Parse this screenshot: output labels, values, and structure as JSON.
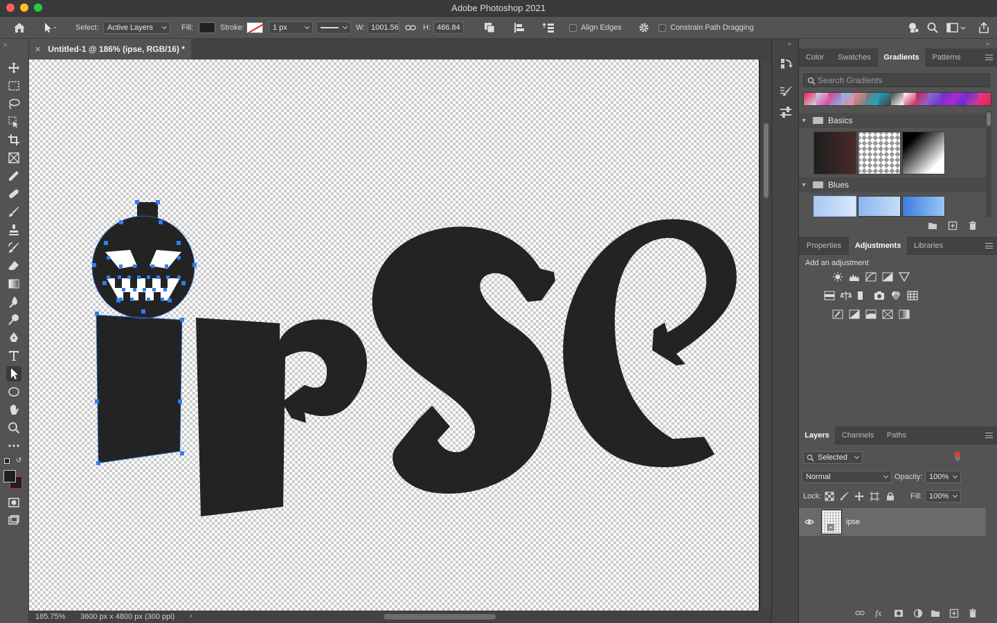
{
  "window": {
    "app_title": "Adobe Photoshop 2021"
  },
  "options_bar": {
    "select_label": "Select:",
    "select_value": "Active Layers",
    "fill_label": "Fill:",
    "stroke_label": "Stroke:",
    "stroke_width": "1 px",
    "w_label": "W:",
    "w_value": "1001.56",
    "h_label": "H:",
    "h_value": "486.84",
    "align_edges": "Align Edges",
    "constrain": "Constrain Path Dragging"
  },
  "document": {
    "tab_title": "Untitled-1 @ 186% (ipse, RGB/16) *",
    "zoom": "185.75%",
    "doc_info": "3600 px x 4800 px (300 ppi)",
    "artwork_text": "ipse"
  },
  "color_panel": {
    "tabs": [
      "Color",
      "Swatches",
      "Gradients",
      "Patterns"
    ],
    "active_tab": "Gradients",
    "search_placeholder": "Search Gradients",
    "groups": [
      {
        "name": "Basics"
      },
      {
        "name": "Blues"
      }
    ],
    "preset_colors": [
      "#e8244d",
      "#c7d7f0",
      "#e43a8f",
      "#7fb6ee",
      "#f18a93",
      "#7a7a7a",
      "#1aa6c2",
      "#444444",
      "#ffffff",
      "#c91f55",
      "#8c6fd6",
      "#6b31c9",
      "#b72ad1",
      "#5c2fd4",
      "#e23b8e"
    ]
  },
  "adjust_panel": {
    "tabs": [
      "Properties",
      "Adjustments",
      "Libraries"
    ],
    "active_tab": "Adjustments",
    "heading": "Add an adjustment"
  },
  "layers_panel": {
    "tabs": [
      "Layers",
      "Channels",
      "Paths"
    ],
    "active_tab": "Layers",
    "filter": "Selected",
    "blend_mode": "Normal",
    "opacity_label": "Opacity:",
    "opacity": "100%",
    "lock_label": "Lock:",
    "fill_label": "Fill:",
    "fill": "100%",
    "layer_name": "ipse"
  },
  "colors": {
    "selection_blue": "#2f7df6",
    "shape_fill": "#232323"
  }
}
